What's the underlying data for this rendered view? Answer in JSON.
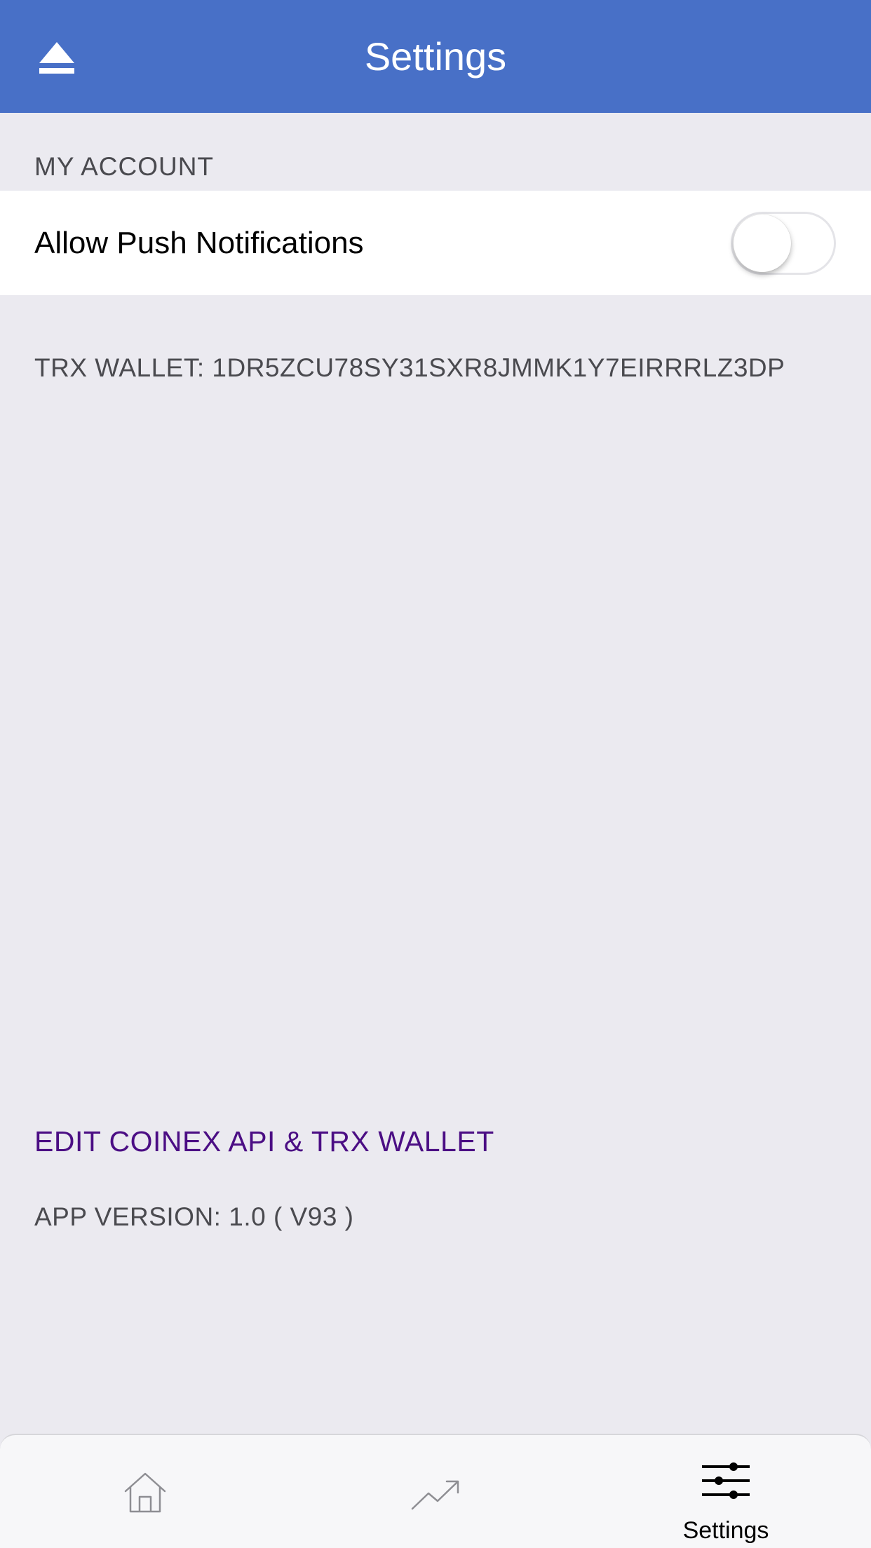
{
  "navbar": {
    "title": "Settings",
    "left_icon": "eject-icon",
    "color": "#4870C7"
  },
  "section": {
    "header": "MY ACCOUNT"
  },
  "push_cell": {
    "label": "Allow Push Notifications",
    "toggle_on": false
  },
  "wallet": {
    "text": "TRX WALLET: 1DR5ZCU78SY31SXR8JMMK1Y7EIRRRLZ3DP"
  },
  "edit_link": {
    "label": "EDIT COINEX API & TRX WALLET",
    "color": "#4B0E84"
  },
  "version": {
    "text": "APP VERSION: 1.0 ( V93 )"
  },
  "tabbar": {
    "tabs": [
      {
        "icon": "home-icon",
        "label": "",
        "selected": false
      },
      {
        "icon": "trending-up-icon",
        "label": "",
        "selected": false
      },
      {
        "icon": "settings-sliders-icon",
        "label": "Settings",
        "selected": true
      }
    ]
  }
}
